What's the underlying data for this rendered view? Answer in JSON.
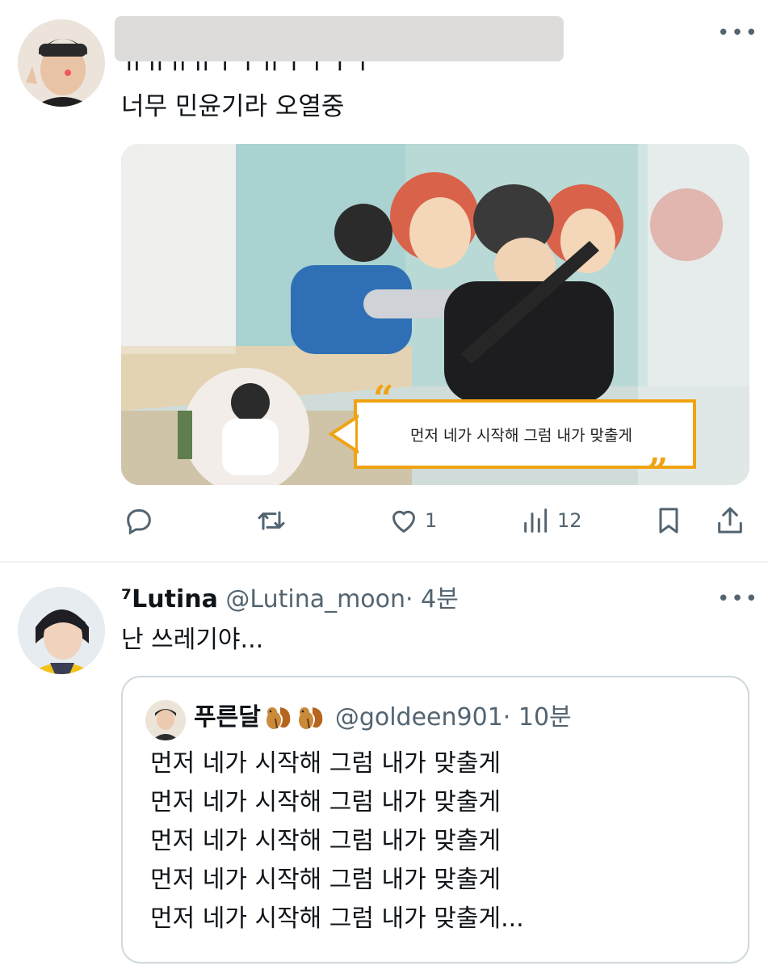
{
  "tweet1": {
    "partial_line": "ㅠㅠㅠㅠㅜㅜㅠㅜㅜㅜㅜ",
    "text": "너무 민윤기라 오열중",
    "more_icon": "more-horizontal-icon",
    "media": {
      "caption": "먼저 네가 시작해 그럼 내가 맞출게"
    },
    "actions": {
      "reply": {
        "icon": "reply-icon",
        "count": ""
      },
      "retweet": {
        "icon": "retweet-icon",
        "count": ""
      },
      "like": {
        "icon": "heart-icon",
        "count": "1"
      },
      "views": {
        "icon": "views-icon",
        "count": "12"
      },
      "bookmark": {
        "icon": "bookmark-icon"
      },
      "share": {
        "icon": "share-icon"
      }
    }
  },
  "tweet2": {
    "name": "⁷Lutina",
    "handle": "@Lutina_moon",
    "time": "· 4분",
    "text": "난 쓰레기야...",
    "more_icon": "more-horizontal-icon",
    "quote": {
      "name": "푸른달",
      "emoji": [
        "chipmunk-emoji",
        "chipmunk-emoji"
      ],
      "handle": "@goldeen901",
      "time": "· 10분",
      "lines": [
        "먼저 네가 시작해 그럼 내가 맞출게",
        "먼저 네가 시작해 그럼 내가 맞출게",
        "먼저 네가 시작해 그럼 내가 맞출게",
        "먼저 네가 시작해 그럼 내가 맞출게",
        "먼저 네가 시작해 그럼 내가 맞출게..."
      ]
    }
  },
  "colors": {
    "text": "#0f1419",
    "secondary": "#536471",
    "border": "#cfd9de",
    "caption_accent": "#f0a312"
  }
}
